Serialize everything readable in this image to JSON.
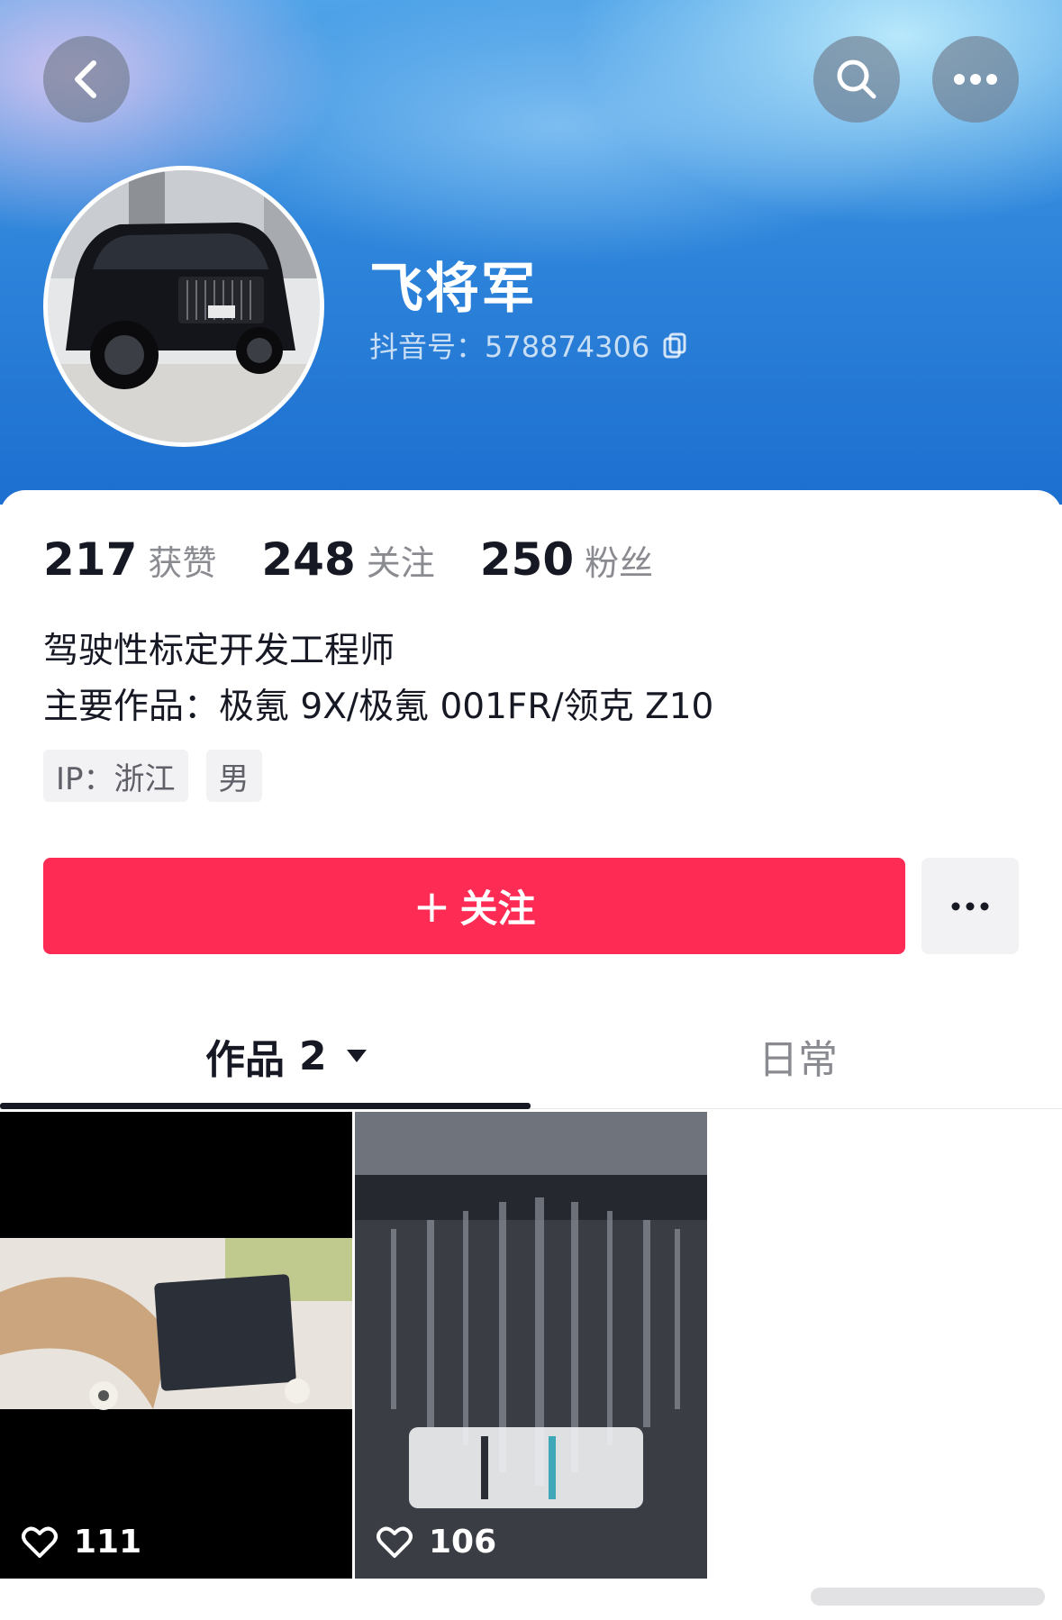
{
  "profile": {
    "nickname": "飞将军",
    "douyin_id": "抖音号：578874306",
    "avatar_description": "black SUV photo"
  },
  "stats": [
    {
      "value": "217",
      "label": "获赞"
    },
    {
      "value": "248",
      "label": "关注"
    },
    {
      "value": "250",
      "label": "粉丝"
    }
  ],
  "bio": {
    "line1": "驾驶性标定开发工程师",
    "line2": "主要作品：极氪 9X/极氪 001FR/领克 Z10"
  },
  "tags": [
    "IP：浙江",
    "男"
  ],
  "actions": {
    "follow_plus": "+",
    "follow_label": "关注"
  },
  "tabs": {
    "works_label": "作品",
    "works_count": "2",
    "daily_label": "日常"
  },
  "videos": [
    {
      "likes": "111"
    },
    {
      "likes": "106"
    }
  ],
  "icons": {
    "back": "back-icon",
    "search": "search-icon",
    "more": "more-icon",
    "copy": "copy-icon",
    "heart": "heart-icon",
    "caret": "caret-down-icon"
  },
  "colors": {
    "follow_button": "#fe2c55",
    "header_gradient": "#2f86db"
  }
}
